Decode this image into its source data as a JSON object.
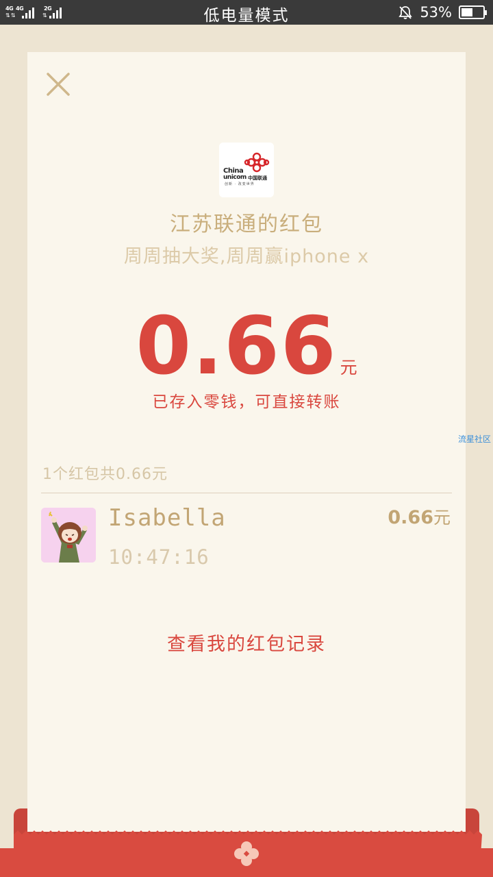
{
  "status_bar": {
    "network_1": "4G",
    "network_2": "4G",
    "network_3": "2G",
    "mode_title": "低电量模式",
    "battery_percent": "53%",
    "battery_level": 0.53
  },
  "red_packet": {
    "brand_logo": {
      "text_line1": "China",
      "text_line2": "unicom",
      "text_cn": "中国联通",
      "slogan": "创新 · 改变世界"
    },
    "sender_title": "江苏联通的红包",
    "wish_message": "周周抽大奖,周周赢iphone x",
    "amount": "0.66",
    "amount_unit": "元",
    "deposit_note": "已存入零钱，可直接转账"
  },
  "watermark": "流星社区",
  "summary": "1个红包共0.66元",
  "receivers": [
    {
      "name": "Isabella",
      "time": "10:47:16",
      "amount": "0.66",
      "unit": "元"
    }
  ],
  "history_link": "查看我的红包记录",
  "colors": {
    "accent_red": "#d9473e",
    "gold": "#c9ae7c",
    "card_bg": "#faf6ec",
    "page_bg": "#ede4d2"
  }
}
